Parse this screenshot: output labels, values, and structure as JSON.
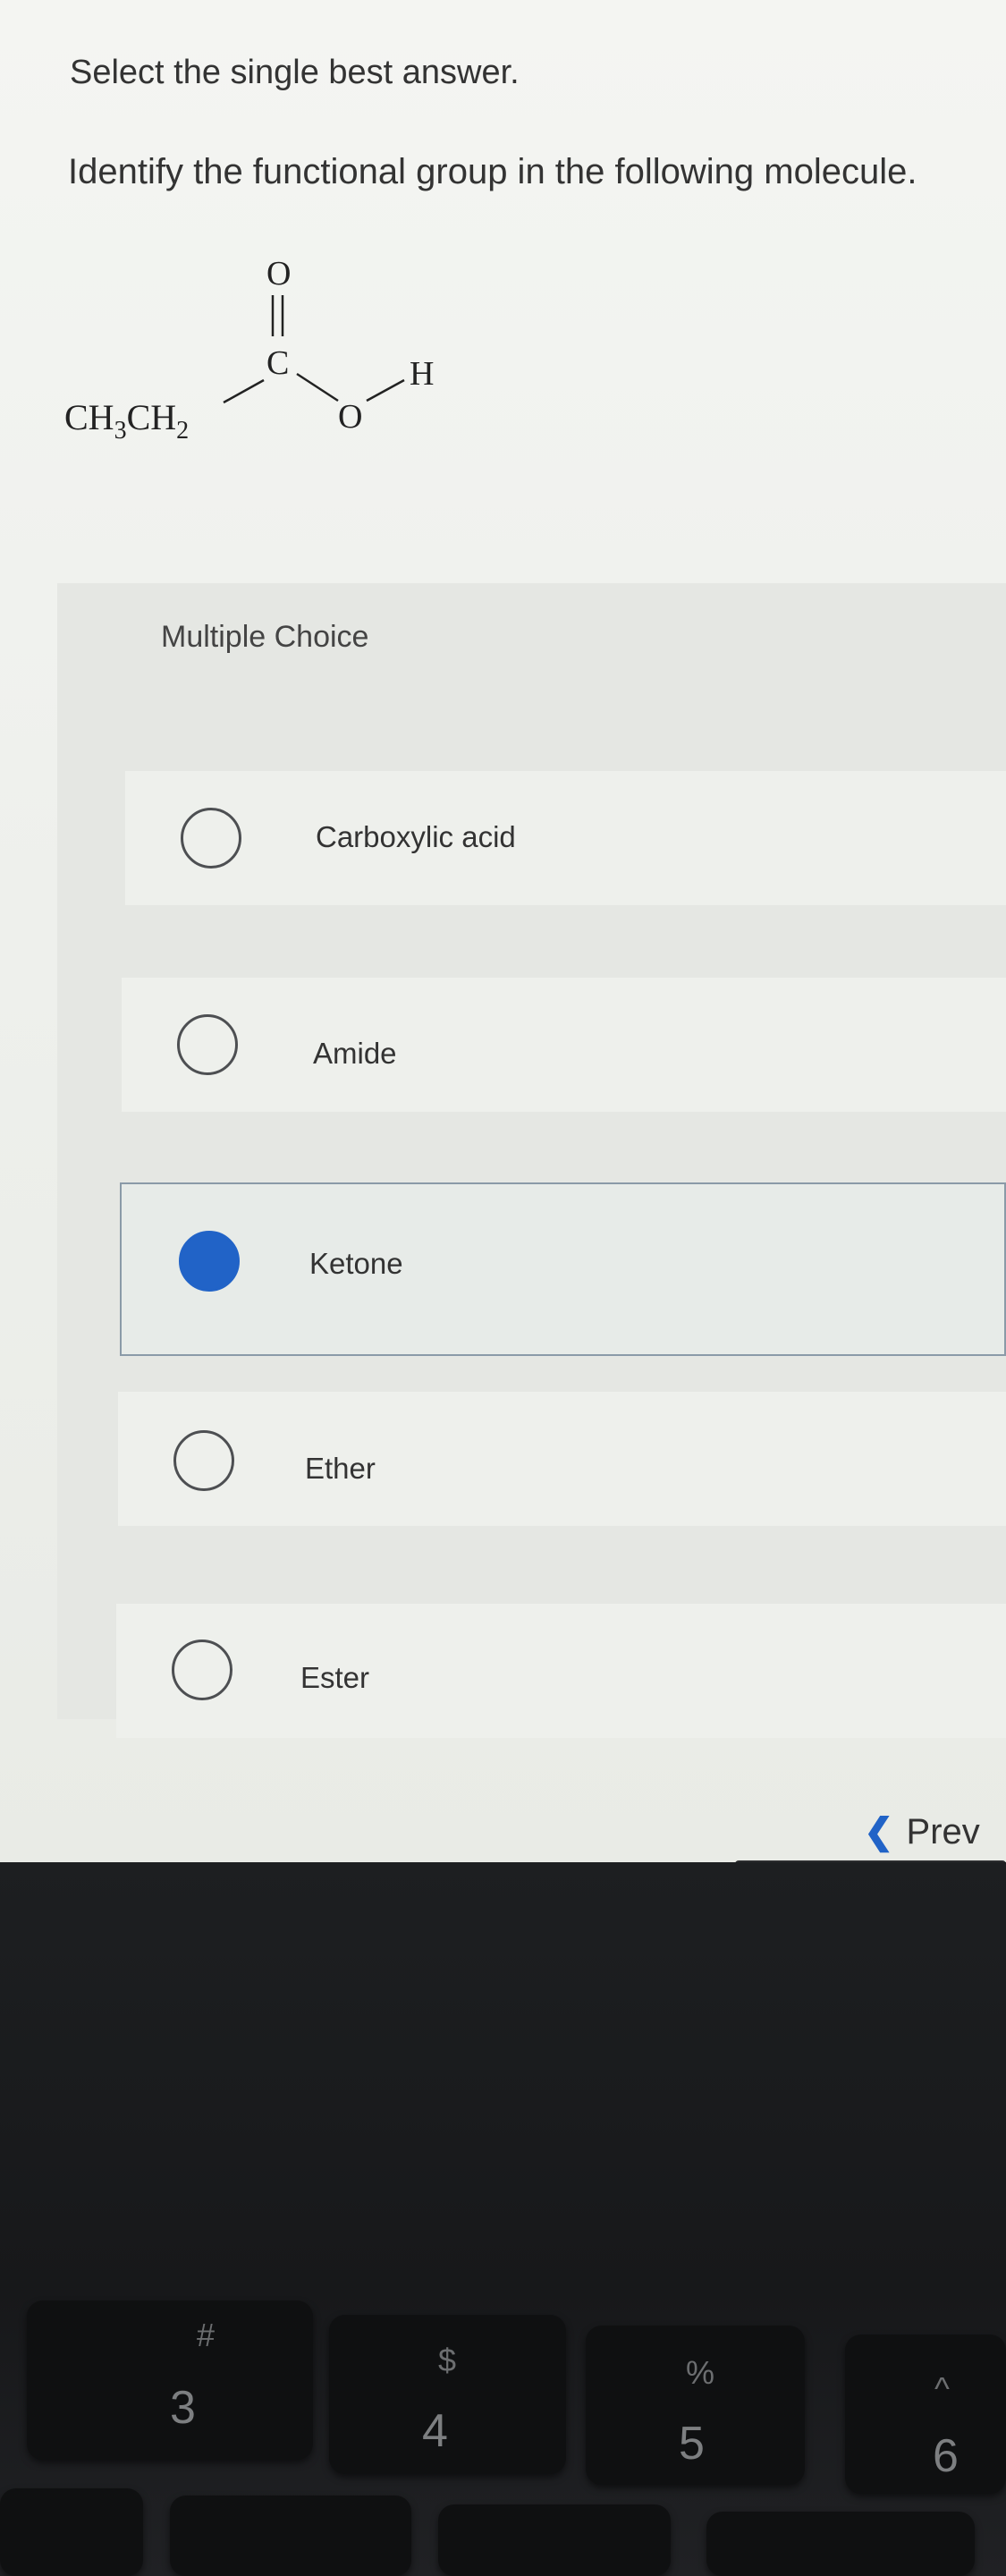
{
  "question": {
    "instruction": "Select the single best answer.",
    "prompt": "Identify the functional group in the following molecule."
  },
  "molecule": {
    "left_group": "CH",
    "left_sub1": "3",
    "left_group2": "CH",
    "left_sub2": "2",
    "carbonyl_o": "O",
    "carbon": "C",
    "ether_o": "O",
    "hydrogen": "H"
  },
  "choices": {
    "title": "Multiple Choice",
    "options": [
      {
        "label": "Carboxylic acid",
        "selected": false
      },
      {
        "label": "Amide",
        "selected": false
      },
      {
        "label": "Ketone",
        "selected": true
      },
      {
        "label": "Ether",
        "selected": false
      },
      {
        "label": "Ester",
        "selected": false
      }
    ]
  },
  "navigation": {
    "prev_icon": "chevron-left-icon",
    "prev_label": "Prev"
  },
  "keyboard": {
    "keys": [
      {
        "symbol": "#",
        "number": "3"
      },
      {
        "symbol": "$",
        "number": "4"
      },
      {
        "symbol": "%",
        "number": "5"
      },
      {
        "symbol": "^",
        "number": "6"
      }
    ]
  },
  "colors": {
    "accent": "#2163c7"
  }
}
